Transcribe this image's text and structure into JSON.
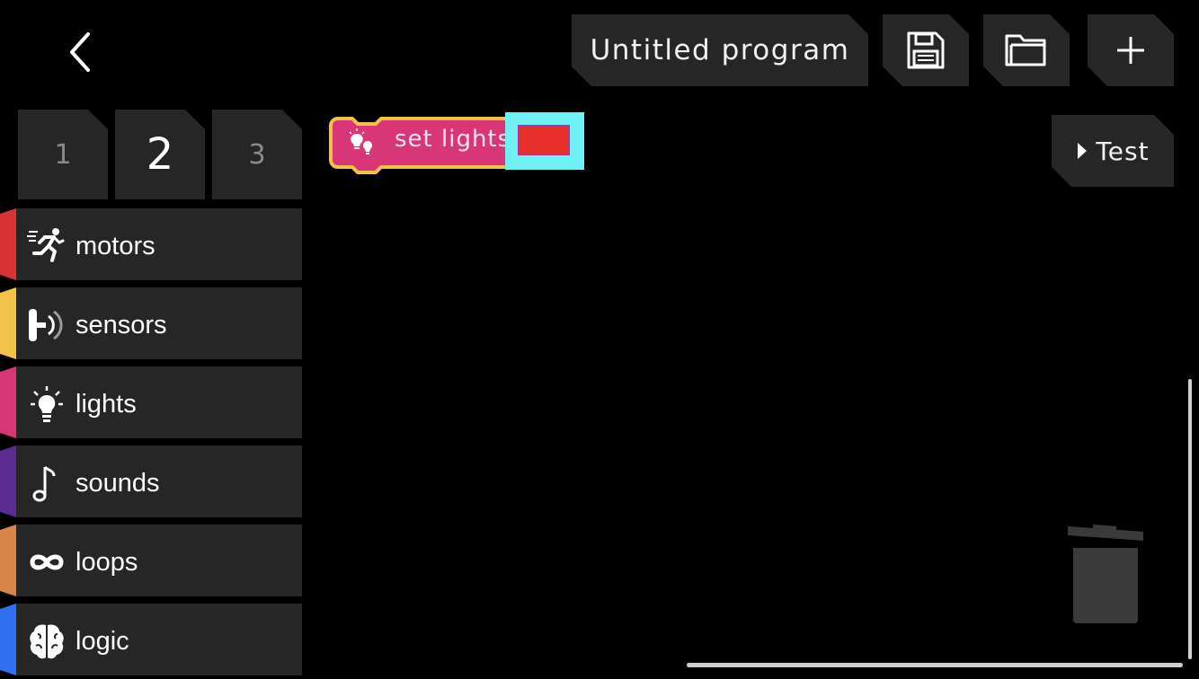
{
  "header": {
    "back_icon": "chevron-left-icon",
    "title": "Untitled program",
    "save_icon": "floppy-disk-icon",
    "open_icon": "folder-icon",
    "new_icon": "plus-icon"
  },
  "tabs": [
    {
      "label": "1",
      "active": false
    },
    {
      "label": "2",
      "active": true
    },
    {
      "label": "3",
      "active": false
    }
  ],
  "categories": [
    {
      "label": "motors",
      "icon": "running-person-icon",
      "color": "#d93434"
    },
    {
      "label": "sensors",
      "icon": "sensor-icon",
      "color": "#f1c14a"
    },
    {
      "label": "lights",
      "icon": "lightbulb-icon",
      "color": "#d93678"
    },
    {
      "label": "sounds",
      "icon": "music-note-icon",
      "color": "#5b2b8f"
    },
    {
      "label": "loops",
      "icon": "infinity-icon",
      "color": "#d9844a"
    },
    {
      "label": "logic",
      "icon": "brain-icon",
      "color": "#2f6ff0"
    }
  ],
  "canvas": {
    "block": {
      "label": "set lights",
      "icon": "lightbulb-icon",
      "block_color": "#d93678",
      "outline_color": "#f1c14a",
      "value_color": "#e8302a",
      "field_highlight": "#6ff0f4"
    },
    "test_label": "Test",
    "test_icon": "play-triangle-icon",
    "trash_icon": "trash-can-icon"
  },
  "colors": {
    "background": "#000000",
    "panel": "#262626"
  }
}
